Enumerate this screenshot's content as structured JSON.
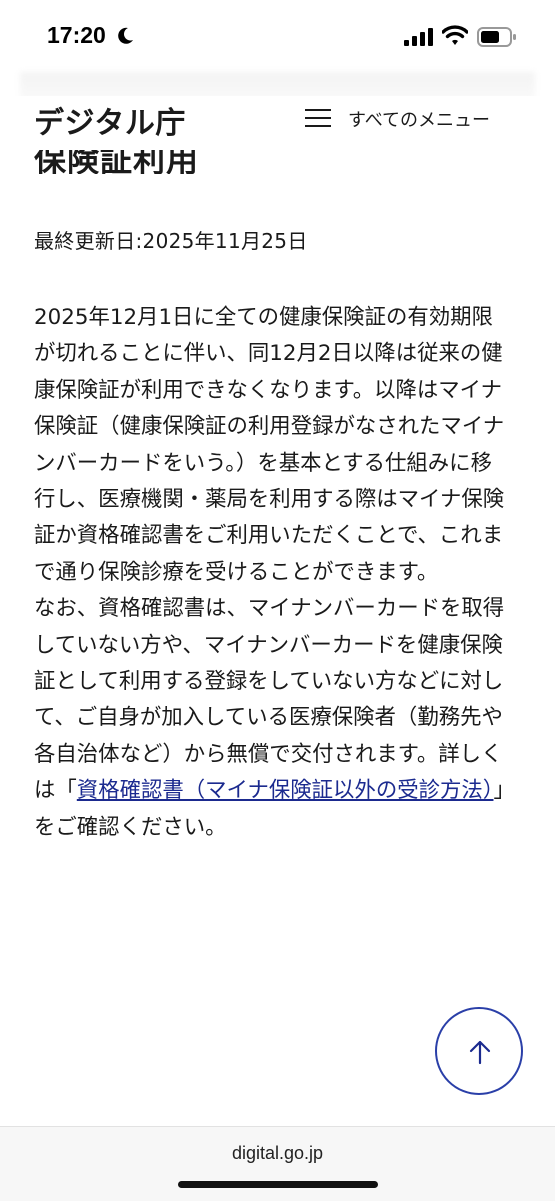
{
  "status_bar": {
    "time": "17:20",
    "icons": [
      "moon-icon",
      "signal-icon",
      "wifi-icon",
      "battery-icon"
    ]
  },
  "header": {
    "logo": "デジタル庁",
    "menu_label": "すべてのメニュー"
  },
  "page": {
    "title_partial": "保険証利用",
    "last_updated": "最終更新日:2025年11月25日",
    "paragraph1": "2025年12月1日に全ての健康保険証の有効期限が切れることに伴い、同12月2日以降は従来の健康保険証が利用できなくなります。以降はマイナ保険証（健康保険証の利用登録がなされたマイナンバーカードをいう。）を基本とする仕組みに移行し、医療機関・薬局を利用する際はマイナ保険証か資格確認書をご利用いただくことで、これまで通り保険診療を受けることができます。",
    "paragraph2_before_link": "なお、資格確認書は、マイナンバーカードを取得していない方や、マイナンバーカードを健康保険証として利用する登録をしていない方などに対して、ご自身が加入している医療保険者（勤務先や各自治体など）から無償で交付されます。詳しくは「",
    "paragraph2_link": "資格確認書（マイナ保険証以外の受診方法）",
    "paragraph2_after_link": "」をご確認ください。"
  },
  "browser": {
    "url": "digital.go.jp"
  },
  "colors": {
    "link": "#1b2a8f",
    "accent": "#2a3fa8",
    "text": "#1a1a1a"
  }
}
